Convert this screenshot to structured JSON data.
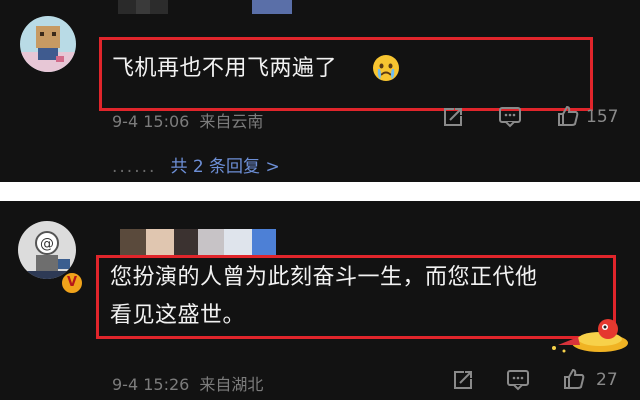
{
  "comments": [
    {
      "text_lines": [
        "飞机再也不用飞两遍了"
      ],
      "date": "9-4 15:06",
      "location": "来自云南",
      "likes": "157",
      "reply_summary": "共 2 条回复 >",
      "emoji": "crying-face-icon"
    },
    {
      "text_lines": [
        "您扮演的人曾为此刻奋斗一生，而您正代他",
        "看见这盛世。"
      ],
      "date": "9-4 15:26",
      "location": "来自湖北",
      "likes": "27",
      "badge": "V",
      "sticker": "firecracker-sticker-icon"
    }
  ],
  "colors": {
    "background": "#121212",
    "highlight_border": "#e0252b",
    "reply_link": "#6d8fd6",
    "meta_text": "#7c7c7c"
  }
}
